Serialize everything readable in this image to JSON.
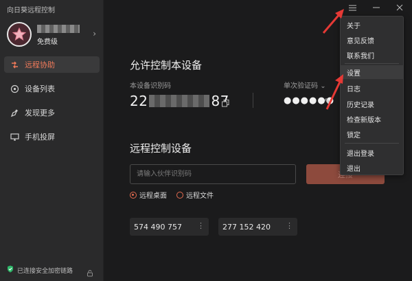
{
  "app": {
    "title": "向日葵远程控制"
  },
  "profile": {
    "username": "",
    "plan": "免费级"
  },
  "nav": [
    {
      "label": "远程协助",
      "icon": "remote-assist-icon",
      "active": true
    },
    {
      "label": "设备列表",
      "icon": "device-list-icon",
      "active": false
    },
    {
      "label": "发现更多",
      "icon": "discover-icon",
      "active": false
    },
    {
      "label": "手机投屏",
      "icon": "screen-cast-icon",
      "active": false
    }
  ],
  "footer": {
    "status": "已连接安全加密链路"
  },
  "allow": {
    "title": "允许控制本设备",
    "id_label": "本设备识别码",
    "id_prefix": "22",
    "id_suffix": "87",
    "code_label": "单次验证码",
    "code_value": "●●●●●●"
  },
  "remote": {
    "title": "远程控制设备",
    "input_placeholder": "请输入伙伴识别码",
    "connect_label": "连接",
    "options": [
      "远程桌面",
      "远程文件"
    ],
    "recent": [
      "574 490 757",
      "277 152 420"
    ]
  },
  "menu": {
    "items": [
      "关于",
      "意见反馈",
      "联系我们",
      "设置",
      "日志",
      "历史记录",
      "检查新版本",
      "锁定",
      "退出登录",
      "退出"
    ],
    "highlighted": "设置"
  },
  "colors": {
    "accent": "#e56c50",
    "arrow": "#e53935",
    "bg": "#1b1b1c",
    "sidebar": "#2a2a2b"
  }
}
